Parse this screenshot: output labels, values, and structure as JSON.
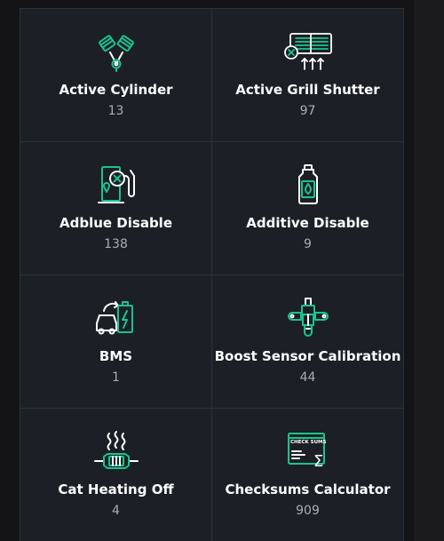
{
  "features": [
    {
      "label": "Active Cylinder",
      "count": "13",
      "icon": "engine-pistons-icon"
    },
    {
      "label": "Active Grill Shutter",
      "count": "97",
      "icon": "grill-shutter-icon"
    },
    {
      "label": "Adblue Disable",
      "count": "138",
      "icon": "adblue-pump-icon"
    },
    {
      "label": "Additive Disable",
      "count": "9",
      "icon": "additive-bottle-icon"
    },
    {
      "label": "BMS",
      "count": "1",
      "icon": "battery-management-icon"
    },
    {
      "label": "Boost Sensor Calibration",
      "count": "44",
      "icon": "boost-sensor-icon"
    },
    {
      "label": "Cat Heating Off",
      "count": "4",
      "icon": "catalyst-heating-icon"
    },
    {
      "label": "Checksums Calculator",
      "count": "909",
      "icon": "checksum-calculator-icon"
    }
  ],
  "icon_text": {
    "checksums": "CHECK SUMS",
    "sigma": "Σ"
  },
  "colors": {
    "accent": "#19c48c",
    "icon_outline": "#ffffff",
    "card_background": "#1c2026",
    "card_border": "#2c3139",
    "page_background": "#141416",
    "count_text": "#a7adb6"
  }
}
